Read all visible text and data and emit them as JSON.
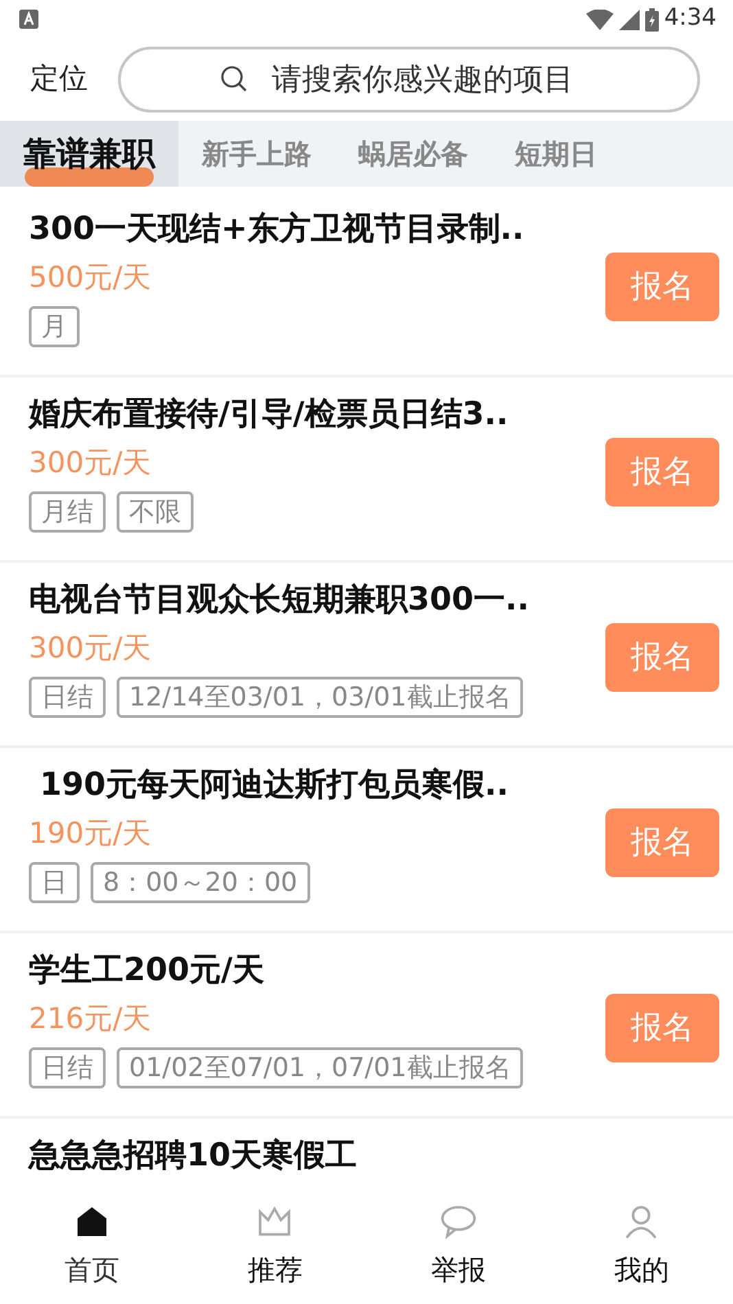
{
  "status_bar": {
    "time": "4:34"
  },
  "header": {
    "location": "定位",
    "search": {
      "placeholder": "请搜索你感兴趣的项目"
    }
  },
  "tabs": [
    {
      "label": "靠谱兼职",
      "selected": true
    },
    {
      "label": "新手上路",
      "selected": false
    },
    {
      "label": "蜗居必备",
      "selected": false
    },
    {
      "label": "短期日",
      "selected": false
    }
  ],
  "jobs": [
    {
      "title": "300一天现结+东方卫视节目录制..",
      "pay": "500元/天",
      "tags": [
        "月"
      ],
      "button": "报名"
    },
    {
      "title": "婚庆布置接待/引导/检票员日结3..",
      "pay": "300元/天",
      "tags": [
        "月结",
        "不限"
      ],
      "button": "报名"
    },
    {
      "title": "电视台节目观众长短期兼职300一..",
      "pay": "300元/天",
      "tags": [
        "日结",
        "12/14至03/01，03/01截止报名"
      ],
      "button": "报名"
    },
    {
      "title": " 190元每天阿迪达斯打包员寒假..",
      "pay": "190元/天",
      "tags": [
        "日",
        "8：00～20：00"
      ],
      "button": "报名"
    },
    {
      "title": "学生工200元/天",
      "pay": "216元/天",
      "tags": [
        "日结",
        "01/02至07/01，07/01截止报名"
      ],
      "button": "报名"
    },
    {
      "title": "急急急招聘10天寒假工"
    }
  ],
  "bottom_nav": [
    {
      "label": "首页",
      "selected": true
    },
    {
      "label": "推荐",
      "selected": false
    },
    {
      "label": "举报",
      "selected": false
    },
    {
      "label": "我的",
      "selected": false
    }
  ]
}
